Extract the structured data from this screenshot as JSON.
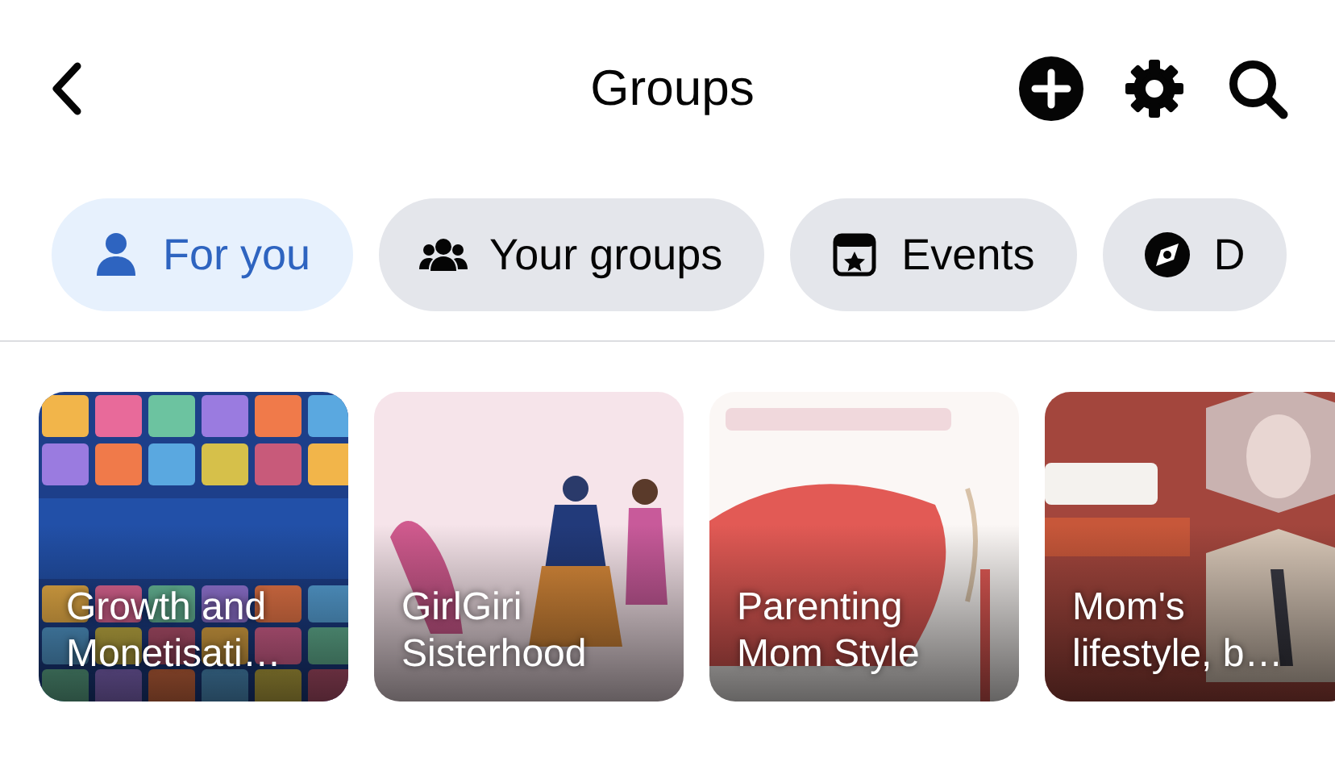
{
  "header": {
    "title": "Groups"
  },
  "tabs": [
    {
      "label": "For you",
      "selected": true,
      "kind": "person"
    },
    {
      "label": "Your groups",
      "selected": false,
      "kind": "people"
    },
    {
      "label": "Events",
      "selected": false,
      "kind": "calendar"
    },
    {
      "label": "D",
      "selected": false,
      "kind": "compass"
    }
  ],
  "groups": [
    {
      "title": "Growth and Monetisati…"
    },
    {
      "title": "GirlGiri Sisterhood"
    },
    {
      "title": "Parenting Mom Style"
    },
    {
      "title": "Mom's lifestyle, b…"
    }
  ]
}
